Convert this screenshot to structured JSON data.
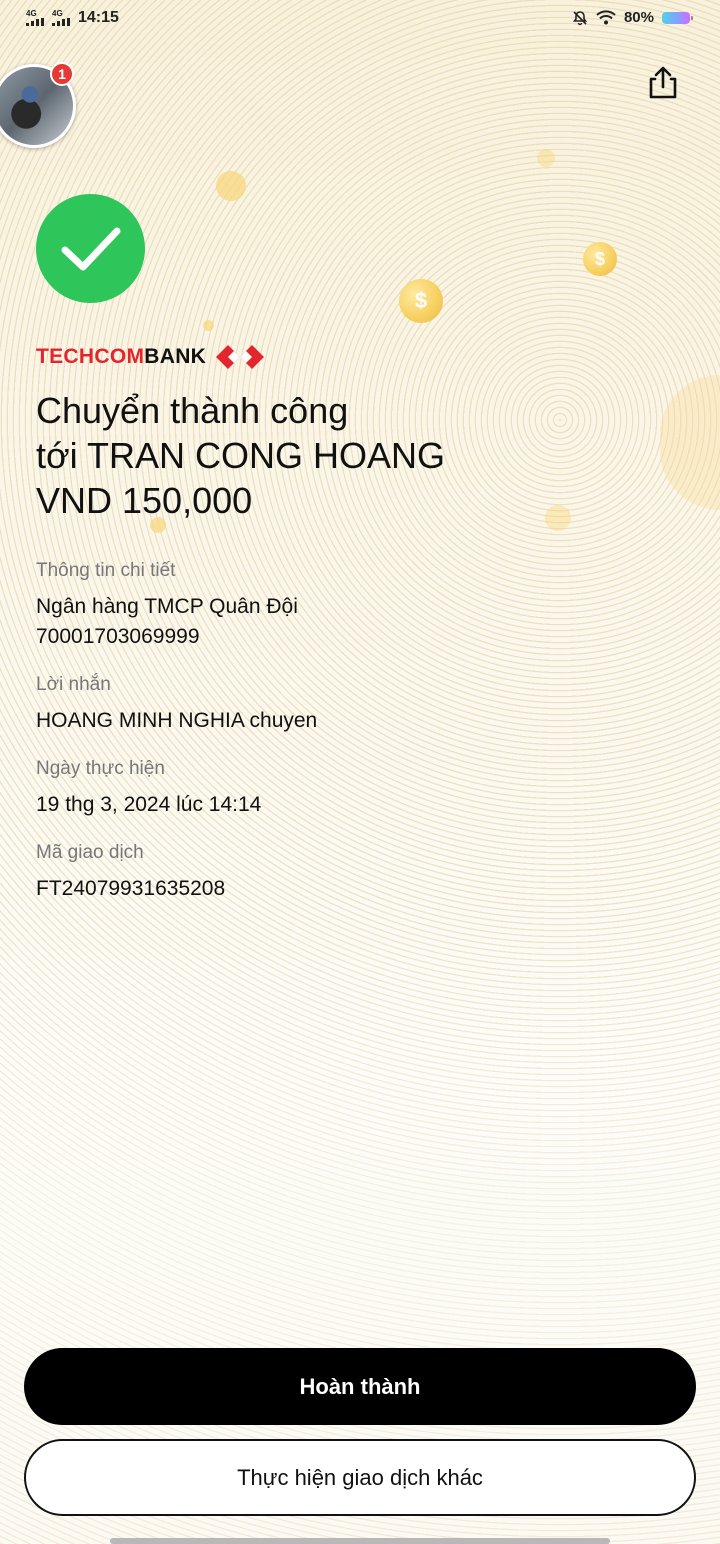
{
  "status_bar": {
    "network_1": "4G",
    "network_2": "4G",
    "time": "14:15",
    "battery": "80%",
    "icons": [
      "mute-bell-icon",
      "wifi-icon",
      "battery-icon"
    ]
  },
  "header": {
    "notification_count": "1",
    "share_icon": "share-icon"
  },
  "brand": {
    "name_part1": "TECHCOM",
    "name_part2": "BANK",
    "accent_color": "#e3262d"
  },
  "result": {
    "line1": "Chuyển thành công",
    "line2": "tới TRAN CONG HOANG",
    "line3": "VND 150,000",
    "status_color": "#2ec55a"
  },
  "details": {
    "section_label": "Thông tin chi tiết",
    "bank_name": "Ngân hàng TMCP Quân Đội",
    "account_number": "70001703069999",
    "message_label": "Lời nhắn",
    "message_value": "HOANG MINH NGHIA chuyen",
    "date_label": "Ngày thực hiện",
    "date_value": "19 thg 3, 2024 lúc 14:14",
    "ref_label": "Mã giao dịch",
    "ref_value": "FT24079931635208"
  },
  "actions": {
    "primary_label": "Hoàn thành",
    "secondary_label": "Thực hiện giao dịch khác"
  },
  "decor": {
    "coin_symbol": "$"
  }
}
